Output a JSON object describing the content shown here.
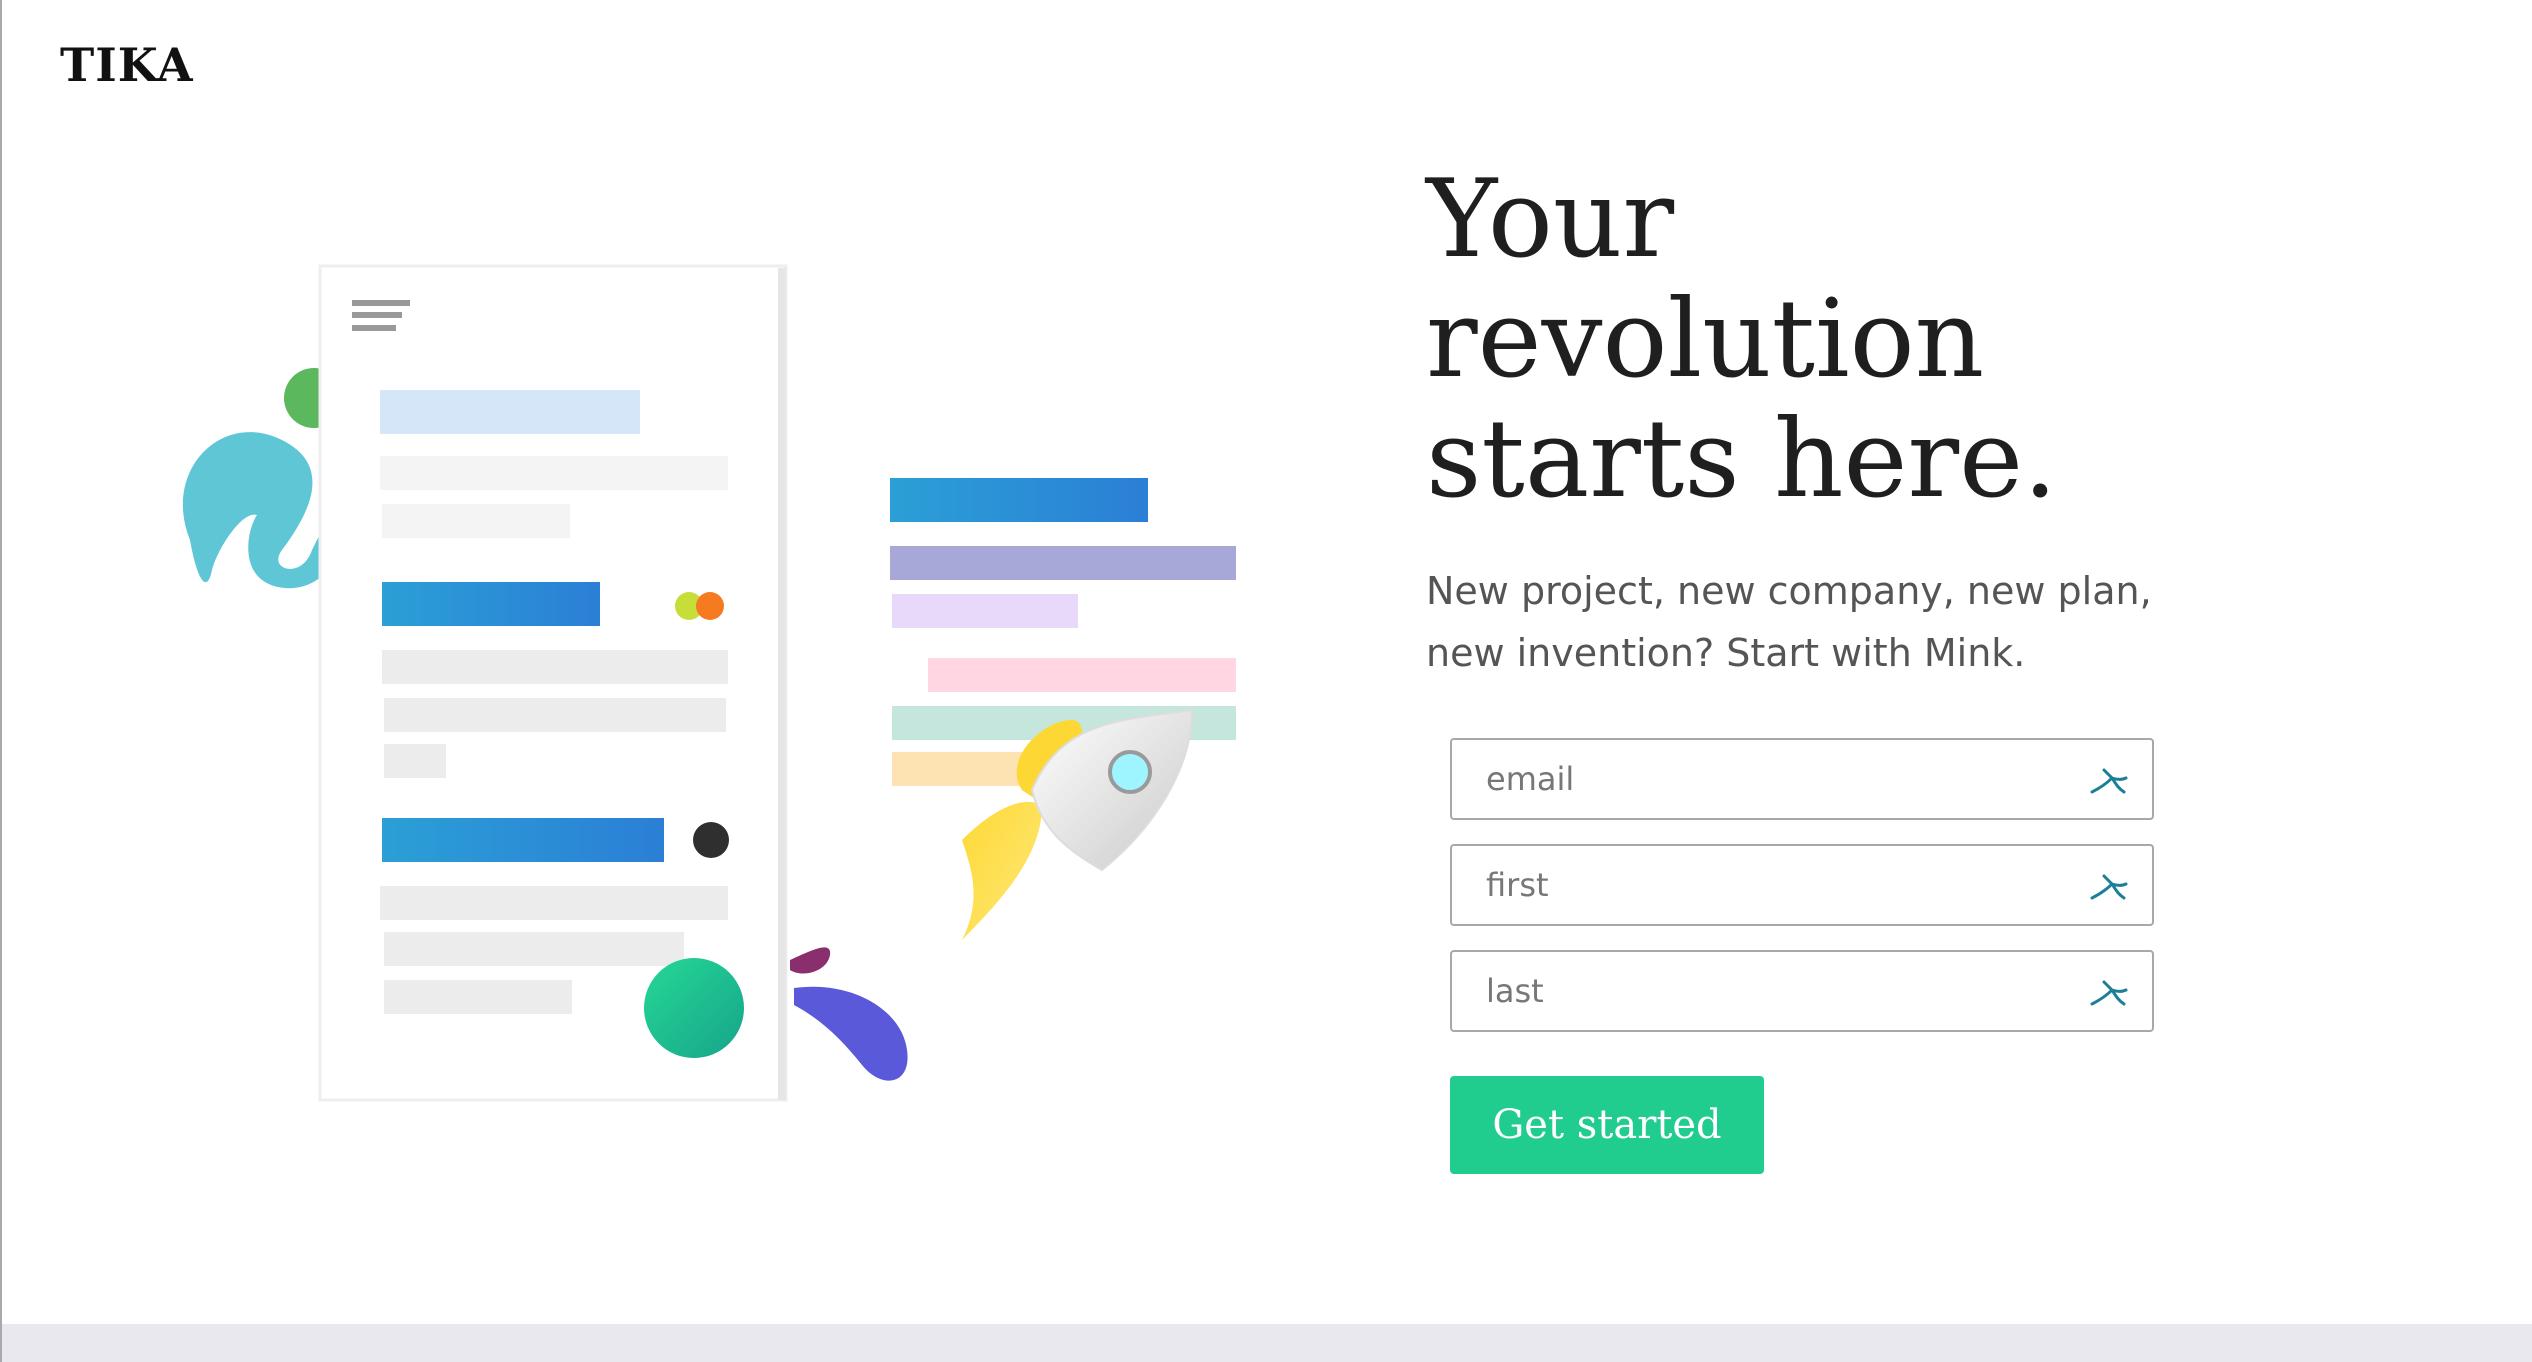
{
  "brand": {
    "logo_text": "TIKA"
  },
  "hero": {
    "title_lines": [
      "Your",
      "revolution",
      "starts here."
    ],
    "subtitle_lines": [
      "New project, new company, new plan,",
      "new invention? Start with Mink."
    ]
  },
  "form": {
    "fields": [
      {
        "placeholder": "email",
        "value": "",
        "icon": "autofill-key-icon"
      },
      {
        "placeholder": "first",
        "value": "",
        "icon": "autofill-key-icon"
      },
      {
        "placeholder": "last",
        "value": "",
        "icon": "autofill-key-icon"
      }
    ],
    "submit_label": "Get started"
  },
  "colors": {
    "accent": "#21cc8f",
    "text_dark": "#1f1f1f",
    "text_muted": "#555555",
    "bottom_bar": "#e8e8ee"
  }
}
